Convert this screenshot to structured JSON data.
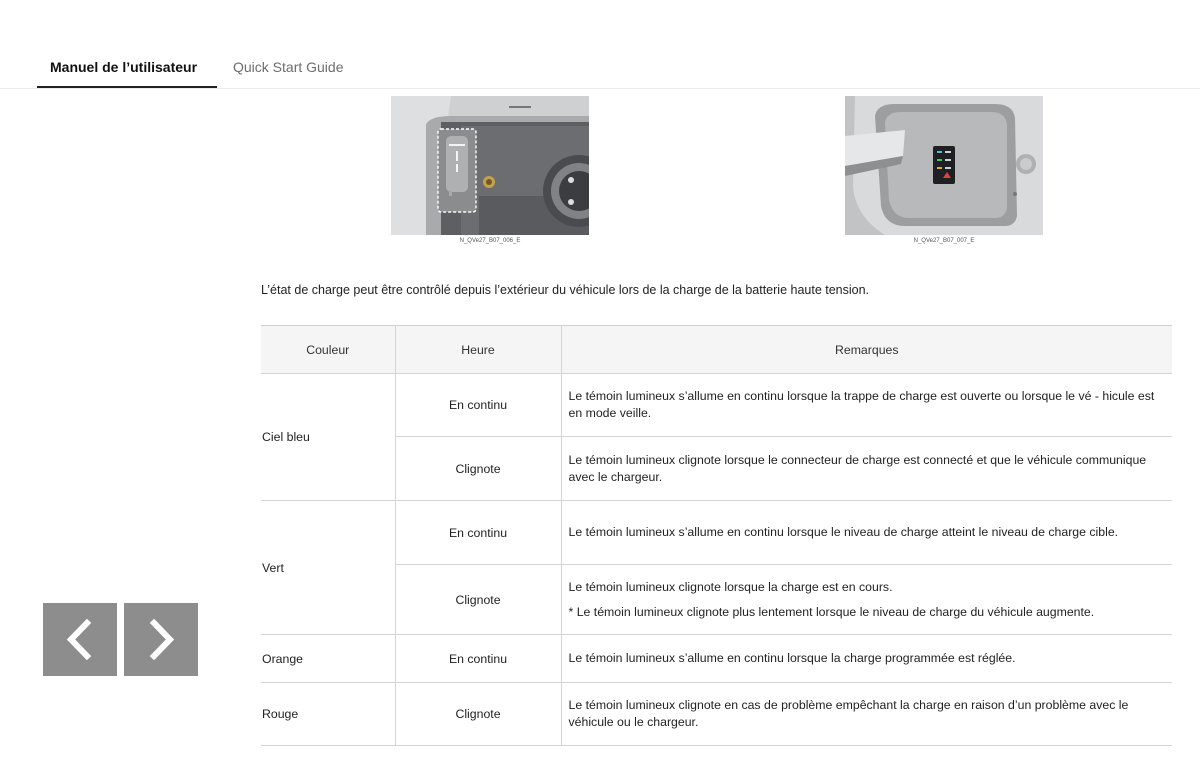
{
  "tabs": [
    {
      "label": "Manuel de l’utilisateur",
      "active": true
    },
    {
      "label": "Quick Start Guide",
      "active": false
    }
  ],
  "figures": [
    {
      "caption": "N_QVe27_B07_006_E",
      "icon": "charging-port-indicator-photo"
    },
    {
      "caption": "N_QVe27_B07_007_E",
      "icon": "charge-door-indicator-photo"
    }
  ],
  "intro": "L’état de charge peut être contrôlé depuis l’extérieur du véhicule lors de la charge de la batterie haute tension.",
  "table": {
    "headers": [
      "Couleur",
      "Heure",
      "Remarques"
    ],
    "rows": [
      {
        "color": "Ciel bleu",
        "time": "En continu",
        "remark": "Le témoin lumineux s’allume en continu lorsque la trappe de charge est ouverte ou lorsque le vé - hicule est en mode veille."
      },
      {
        "color": "",
        "time": "Clignote",
        "remark": "Le témoin lumineux clignote lorsque le connecteur de charge est connecté et que le véhicule communique avec le chargeur."
      },
      {
        "color": "Vert",
        "time": "En continu",
        "remark": "Le témoin lumineux s’allume en continu lorsque le niveau de charge atteint le niveau de charge cible."
      },
      {
        "color": "",
        "time": "Clignote",
        "remark": "Le témoin lumineux clignote lorsque la charge est en cours.",
        "note": "* Le témoin lumineux clignote plus lentement lorsque le niveau de charge du véhicule augmente."
      },
      {
        "color": "Orange",
        "time": "En continu",
        "remark": "Le témoin lumineux s’allume en continu lorsque la charge programmée est réglée."
      },
      {
        "color": "Rouge",
        "time": "Clignote",
        "remark": "Le témoin lumineux clignote en cas de problème empêchant la charge en raison d’un problème avec le véhicule ou le chargeur."
      }
    ]
  },
  "nav": {
    "prev_icon": "chevron-left-icon",
    "next_icon": "chevron-right-icon",
    "button_color": "#8d8d8d"
  }
}
